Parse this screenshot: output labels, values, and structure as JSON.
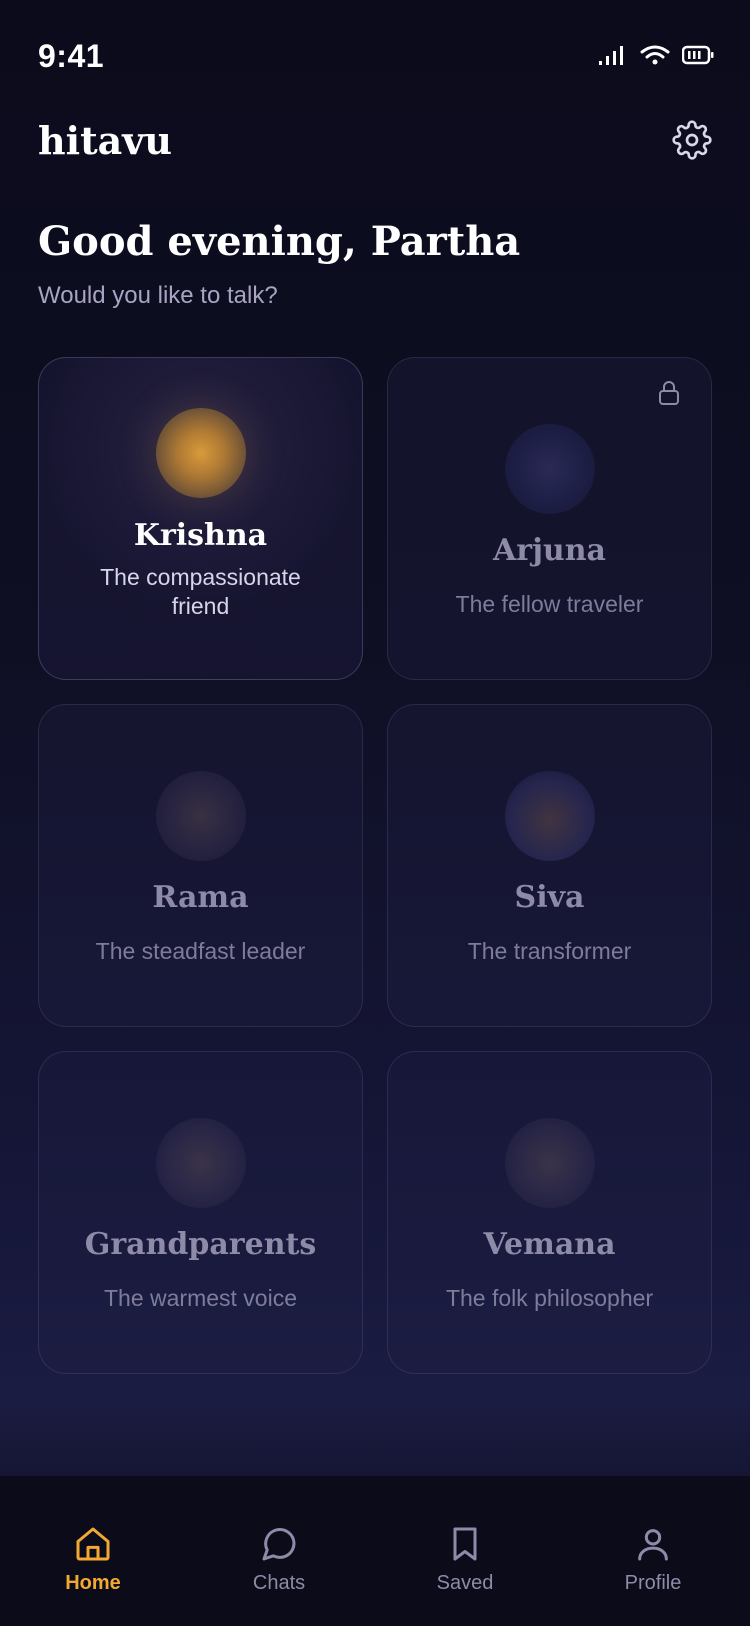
{
  "status": {
    "time": "9:41"
  },
  "app": {
    "name": "hitavu"
  },
  "greeting": {
    "title": "Good evening, Partha",
    "subtitle": "Would you like to talk?"
  },
  "companions": [
    {
      "name": "Krishna",
      "desc": "The compassionate friend",
      "state": "active"
    },
    {
      "name": "Arjuna",
      "desc": "The fellow traveler",
      "state": "locked"
    },
    {
      "name": "Rama",
      "desc": "The steadfast leader",
      "state": "normal"
    },
    {
      "name": "Siva",
      "desc": "The transformer",
      "state": "normal"
    },
    {
      "name": "Grandparents",
      "desc": "The warmest voice",
      "state": "normal"
    },
    {
      "name": "Vemana",
      "desc": "The folk philosopher",
      "state": "normal"
    }
  ],
  "tabs": [
    {
      "label": "Home",
      "icon": "home-icon",
      "active": true
    },
    {
      "label": "Chats",
      "icon": "chat-icon",
      "active": false
    },
    {
      "label": "Saved",
      "icon": "bookmark-icon",
      "active": false
    },
    {
      "label": "Profile",
      "icon": "person-icon",
      "active": false
    }
  ],
  "colors": {
    "accent": "#f3a832",
    "background": "#0b0b1c",
    "inactive": "#8e8aa8"
  }
}
